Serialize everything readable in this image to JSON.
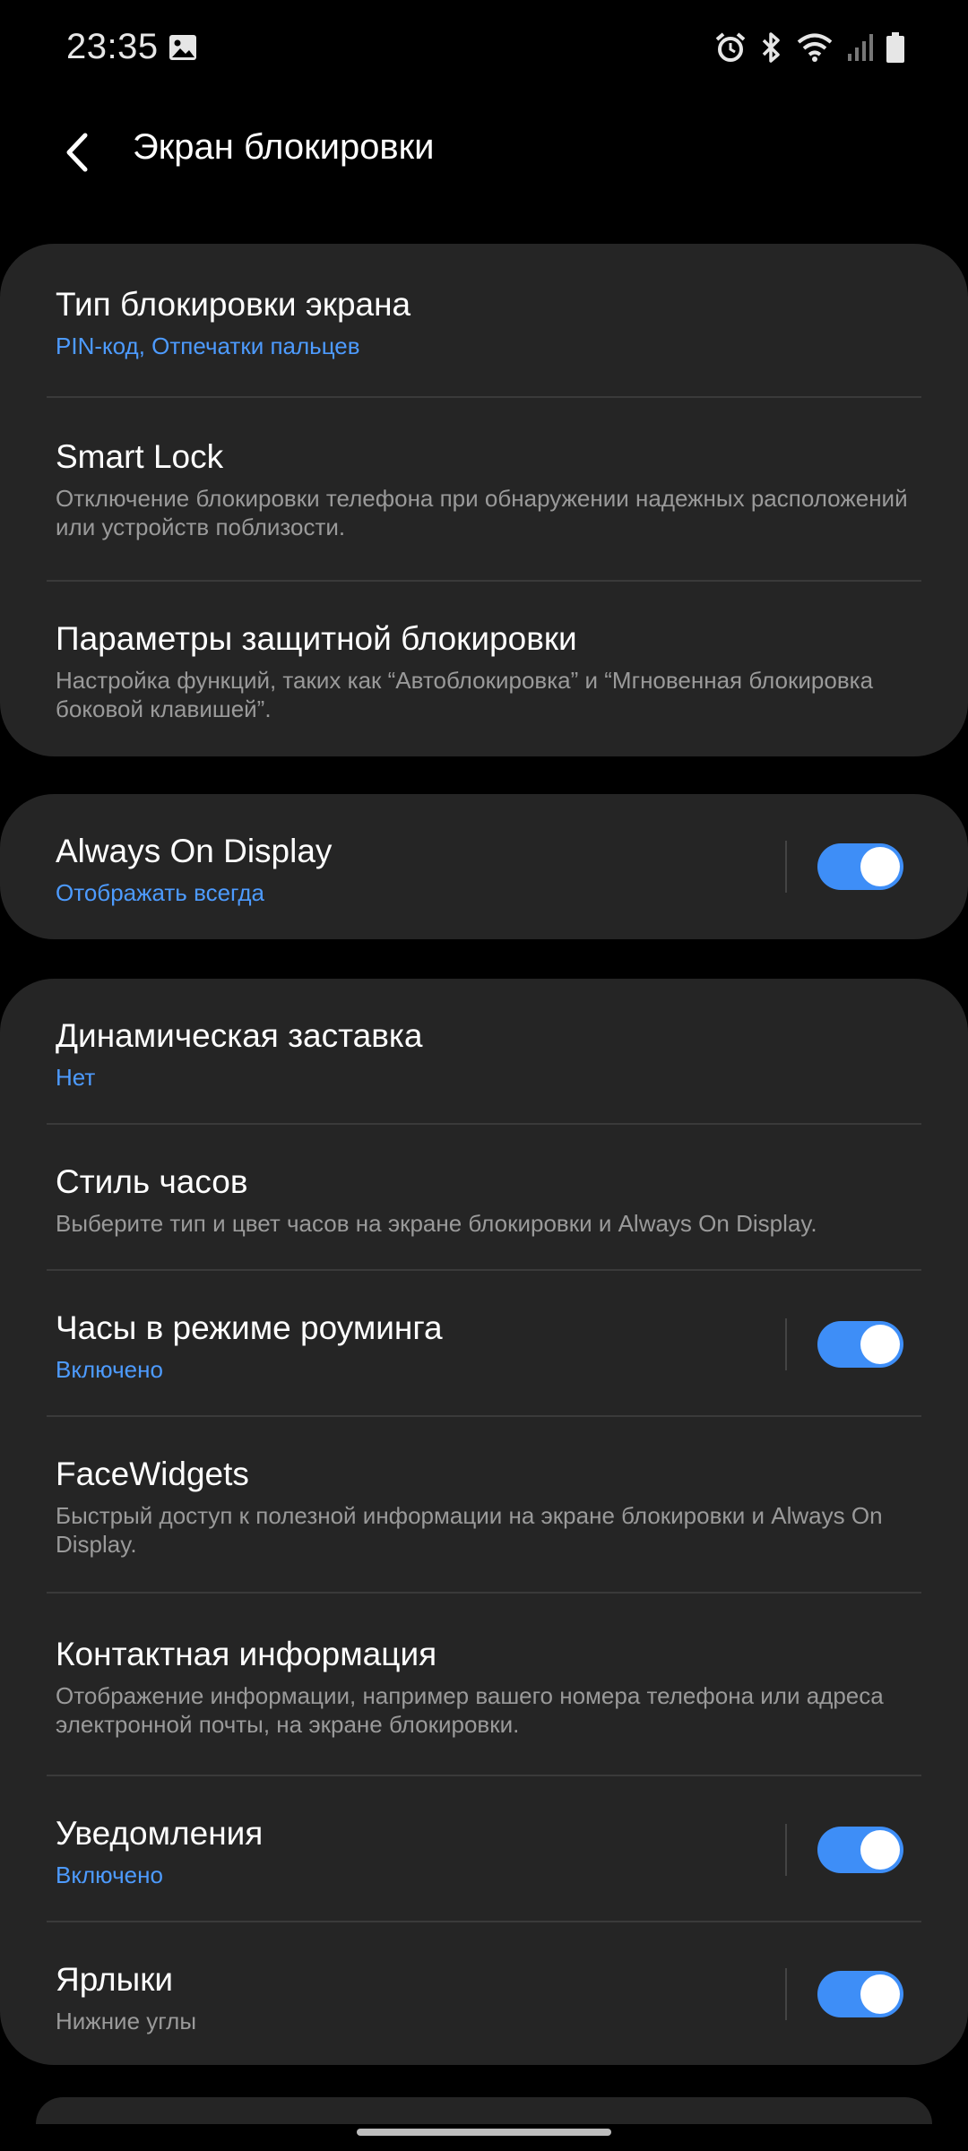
{
  "status_bar": {
    "time": "23:35",
    "icons": [
      "gallery-icon",
      "alarm-icon",
      "bluetooth-icon",
      "wifi-icon",
      "signal-icon",
      "battery-icon"
    ]
  },
  "header": {
    "title": "Экран блокировки",
    "back_icon": "back-arrow-icon"
  },
  "colors": {
    "background": "#000000",
    "card": "#252525",
    "accent": "#4d9bff",
    "toggle_on": "#3e8ef7",
    "subtitle": "#9a9a9a"
  },
  "groups": [
    {
      "items": [
        {
          "title": "Тип блокировки экрана",
          "subtitle": "PIN-код, Отпечатки пальцев",
          "subtitle_style": "accent"
        },
        {
          "title": "Smart Lock",
          "subtitle": "Отключение блокировки телефона при обнаружении надежных расположений или устройств поблизости.",
          "subtitle_style": "normal"
        },
        {
          "title": "Параметры защитной блокировки",
          "subtitle": "Настройка функций, таких как “Автоблокировка” и “Мгновенная блокировка боковой клавишей”.",
          "subtitle_style": "normal"
        }
      ]
    },
    {
      "items": [
        {
          "title": "Always On Display",
          "subtitle": "Отображать всегда",
          "subtitle_style": "accent",
          "toggle": true
        }
      ]
    },
    {
      "items": [
        {
          "title": "Динамическая заставка",
          "subtitle": "Нет",
          "subtitle_style": "accent"
        },
        {
          "title": "Стиль часов",
          "subtitle": "Выберите тип и цвет часов на экране блокировки и Always On Display.",
          "subtitle_style": "normal"
        },
        {
          "title": "Часы в режиме роуминга",
          "subtitle": "Включено",
          "subtitle_style": "accent",
          "toggle": true
        },
        {
          "title": "FaceWidgets",
          "subtitle": "Быстрый доступ к полезной информации на экране блокировки и Always On Display.",
          "subtitle_style": "normal"
        },
        {
          "title": "Контактная информация",
          "subtitle": "Отображение информации, например вашего номера телефона или адреса электронной почты, на экране блокировки.",
          "subtitle_style": "normal"
        },
        {
          "title": "Уведомления",
          "subtitle": "Включено",
          "subtitle_style": "accent",
          "toggle": true
        },
        {
          "title": "Ярлыки",
          "subtitle": "Нижние углы",
          "subtitle_style": "normal",
          "toggle": true
        }
      ]
    }
  ]
}
